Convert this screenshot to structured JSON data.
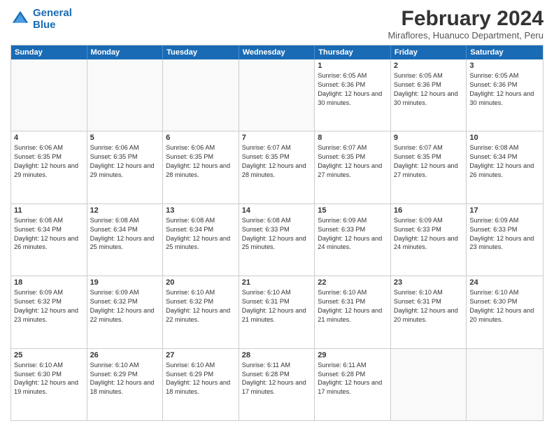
{
  "logo": {
    "line1": "General",
    "line2": "Blue"
  },
  "title": "February 2024",
  "location": "Miraflores, Huanuco Department, Peru",
  "days_of_week": [
    "Sunday",
    "Monday",
    "Tuesday",
    "Wednesday",
    "Thursday",
    "Friday",
    "Saturday"
  ],
  "weeks": [
    [
      {
        "day": "",
        "info": ""
      },
      {
        "day": "",
        "info": ""
      },
      {
        "day": "",
        "info": ""
      },
      {
        "day": "",
        "info": ""
      },
      {
        "day": "1",
        "sunrise": "6:05 AM",
        "sunset": "6:36 PM",
        "daylight": "12 hours and 30 minutes."
      },
      {
        "day": "2",
        "sunrise": "6:05 AM",
        "sunset": "6:36 PM",
        "daylight": "12 hours and 30 minutes."
      },
      {
        "day": "3",
        "sunrise": "6:05 AM",
        "sunset": "6:36 PM",
        "daylight": "12 hours and 30 minutes."
      }
    ],
    [
      {
        "day": "4",
        "sunrise": "6:06 AM",
        "sunset": "6:35 PM",
        "daylight": "12 hours and 29 minutes."
      },
      {
        "day": "5",
        "sunrise": "6:06 AM",
        "sunset": "6:35 PM",
        "daylight": "12 hours and 29 minutes."
      },
      {
        "day": "6",
        "sunrise": "6:06 AM",
        "sunset": "6:35 PM",
        "daylight": "12 hours and 28 minutes."
      },
      {
        "day": "7",
        "sunrise": "6:07 AM",
        "sunset": "6:35 PM",
        "daylight": "12 hours and 28 minutes."
      },
      {
        "day": "8",
        "sunrise": "6:07 AM",
        "sunset": "6:35 PM",
        "daylight": "12 hours and 27 minutes."
      },
      {
        "day": "9",
        "sunrise": "6:07 AM",
        "sunset": "6:35 PM",
        "daylight": "12 hours and 27 minutes."
      },
      {
        "day": "10",
        "sunrise": "6:08 AM",
        "sunset": "6:34 PM",
        "daylight": "12 hours and 26 minutes."
      }
    ],
    [
      {
        "day": "11",
        "sunrise": "6:08 AM",
        "sunset": "6:34 PM",
        "daylight": "12 hours and 26 minutes."
      },
      {
        "day": "12",
        "sunrise": "6:08 AM",
        "sunset": "6:34 PM",
        "daylight": "12 hours and 25 minutes."
      },
      {
        "day": "13",
        "sunrise": "6:08 AM",
        "sunset": "6:34 PM",
        "daylight": "12 hours and 25 minutes."
      },
      {
        "day": "14",
        "sunrise": "6:08 AM",
        "sunset": "6:33 PM",
        "daylight": "12 hours and 25 minutes."
      },
      {
        "day": "15",
        "sunrise": "6:09 AM",
        "sunset": "6:33 PM",
        "daylight": "12 hours and 24 minutes."
      },
      {
        "day": "16",
        "sunrise": "6:09 AM",
        "sunset": "6:33 PM",
        "daylight": "12 hours and 24 minutes."
      },
      {
        "day": "17",
        "sunrise": "6:09 AM",
        "sunset": "6:33 PM",
        "daylight": "12 hours and 23 minutes."
      }
    ],
    [
      {
        "day": "18",
        "sunrise": "6:09 AM",
        "sunset": "6:32 PM",
        "daylight": "12 hours and 23 minutes."
      },
      {
        "day": "19",
        "sunrise": "6:09 AM",
        "sunset": "6:32 PM",
        "daylight": "12 hours and 22 minutes."
      },
      {
        "day": "20",
        "sunrise": "6:10 AM",
        "sunset": "6:32 PM",
        "daylight": "12 hours and 22 minutes."
      },
      {
        "day": "21",
        "sunrise": "6:10 AM",
        "sunset": "6:31 PM",
        "daylight": "12 hours and 21 minutes."
      },
      {
        "day": "22",
        "sunrise": "6:10 AM",
        "sunset": "6:31 PM",
        "daylight": "12 hours and 21 minutes."
      },
      {
        "day": "23",
        "sunrise": "6:10 AM",
        "sunset": "6:31 PM",
        "daylight": "12 hours and 20 minutes."
      },
      {
        "day": "24",
        "sunrise": "6:10 AM",
        "sunset": "6:30 PM",
        "daylight": "12 hours and 20 minutes."
      }
    ],
    [
      {
        "day": "25",
        "sunrise": "6:10 AM",
        "sunset": "6:30 PM",
        "daylight": "12 hours and 19 minutes."
      },
      {
        "day": "26",
        "sunrise": "6:10 AM",
        "sunset": "6:29 PM",
        "daylight": "12 hours and 18 minutes."
      },
      {
        "day": "27",
        "sunrise": "6:10 AM",
        "sunset": "6:29 PM",
        "daylight": "12 hours and 18 minutes."
      },
      {
        "day": "28",
        "sunrise": "6:11 AM",
        "sunset": "6:28 PM",
        "daylight": "12 hours and 17 minutes."
      },
      {
        "day": "29",
        "sunrise": "6:11 AM",
        "sunset": "6:28 PM",
        "daylight": "12 hours and 17 minutes."
      },
      {
        "day": "",
        "info": ""
      },
      {
        "day": "",
        "info": ""
      }
    ]
  ]
}
